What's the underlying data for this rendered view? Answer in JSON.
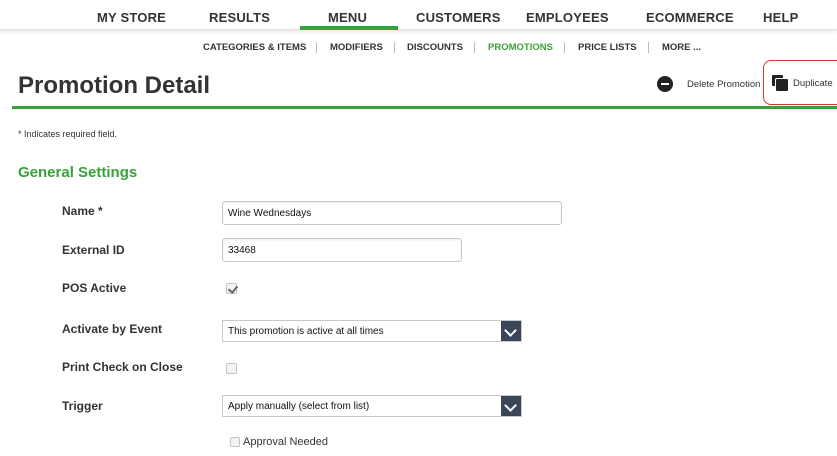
{
  "topnav": {
    "items": [
      "MY STORE",
      "RESULTS",
      "MENU",
      "CUSTOMERS",
      "EMPLOYEES",
      "ECOMMERCE",
      "HELP"
    ],
    "active": "MENU"
  },
  "subnav": {
    "items": [
      "CATEGORIES & ITEMS",
      "MODIFIERS",
      "DISCOUNTS",
      "PROMOTIONS",
      "PRICE LISTS",
      "MORE ..."
    ],
    "active": "PROMOTIONS"
  },
  "page": {
    "title": "Promotion Detail",
    "delete_label": "Delete Promotion",
    "duplicate_label": "Duplicate"
  },
  "form": {
    "required_note": "* Indicates required field.",
    "section_title": "General Settings",
    "name_label": "Name *",
    "name_value": "Wine Wednesdays",
    "external_id_label": "External ID",
    "external_id_value": "33468",
    "pos_active_label": "POS Active",
    "pos_active_checked": true,
    "activate_label": "Activate by Event",
    "activate_value": "This promotion is active at all times",
    "print_check_label": "Print Check on Close",
    "print_check_checked": false,
    "trigger_label": "Trigger",
    "trigger_value": "Apply manually (select from list)",
    "approval_label": "Approval Needed",
    "approval_checked": false
  },
  "colors": {
    "accent_green": "#3aa13a",
    "highlight_red": "#d9342b",
    "select_arrow_bg": "#3a4558"
  }
}
